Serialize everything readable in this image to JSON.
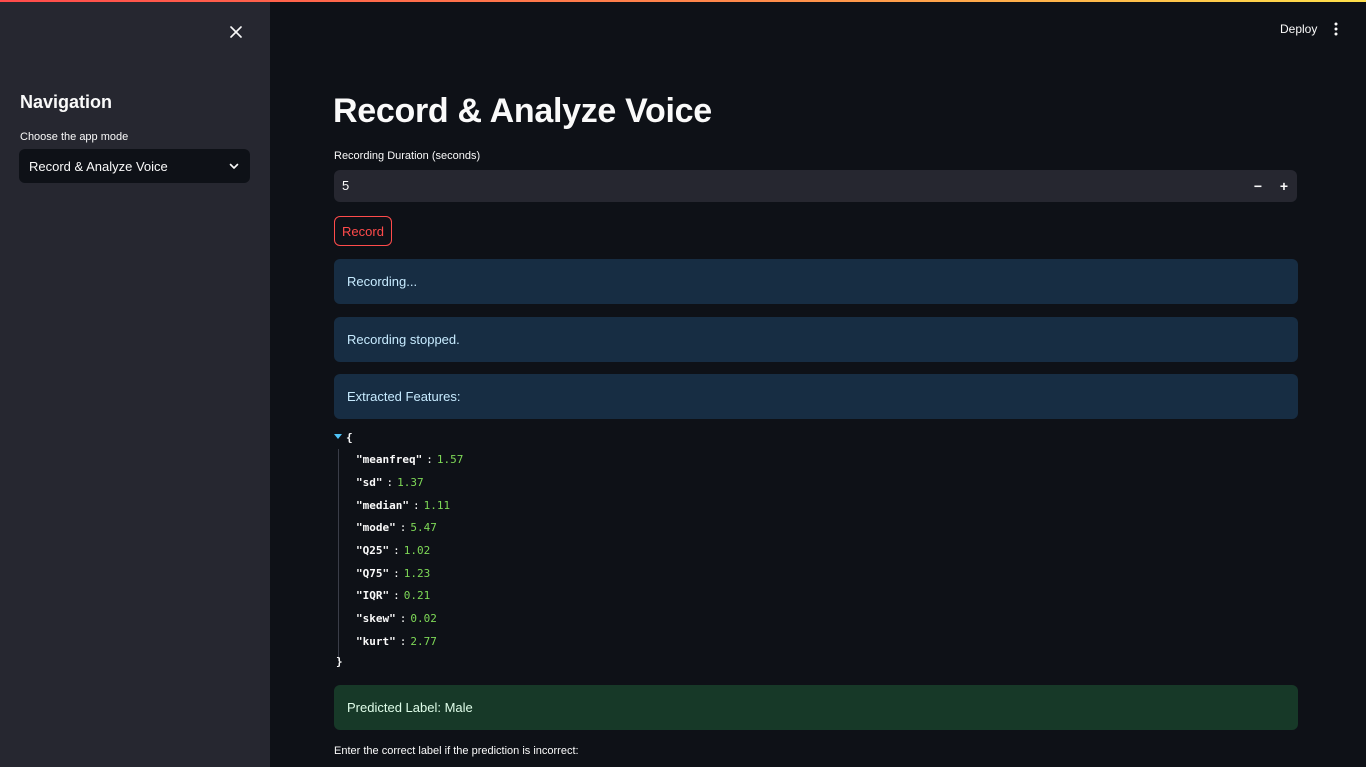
{
  "sidebar": {
    "title": "Navigation",
    "mode_label": "Choose the app mode",
    "mode_selected": "Record & Analyze Voice"
  },
  "header": {
    "deploy_label": "Deploy"
  },
  "main": {
    "title": "Record & Analyze Voice",
    "duration_label": "Recording Duration (seconds)",
    "duration_value": "5",
    "decrement_label": "−",
    "increment_label": "+",
    "record_label": "Record",
    "alerts": {
      "recording": "Recording...",
      "stopped": "Recording stopped.",
      "features": "Extracted Features:",
      "prediction": "Predicted Label: Male"
    },
    "features": [
      {
        "key": "\"meanfreq\"",
        "value": "1.57"
      },
      {
        "key": "\"sd\"",
        "value": "1.37"
      },
      {
        "key": "\"median\"",
        "value": "1.11"
      },
      {
        "key": "\"mode\"",
        "value": "5.47"
      },
      {
        "key": "\"Q25\"",
        "value": "1.02"
      },
      {
        "key": "\"Q75\"",
        "value": "1.23"
      },
      {
        "key": "\"IQR\"",
        "value": "0.21"
      },
      {
        "key": "\"skew\"",
        "value": "0.02"
      },
      {
        "key": "\"kurt\"",
        "value": "2.77"
      }
    ],
    "json_open": "{",
    "json_close": "}",
    "correct_label_prompt": "Enter the correct label if the prediction is incorrect:"
  },
  "colors": {
    "accent": "#ff4b4b",
    "info_bg": "#172d43",
    "success_bg": "#173928",
    "json_number": "#7ed957"
  },
  "icons": {
    "sidebar_close": "close-icon",
    "select_chevron": "chevron-down-icon",
    "main_menu": "more-vertical-icon"
  }
}
